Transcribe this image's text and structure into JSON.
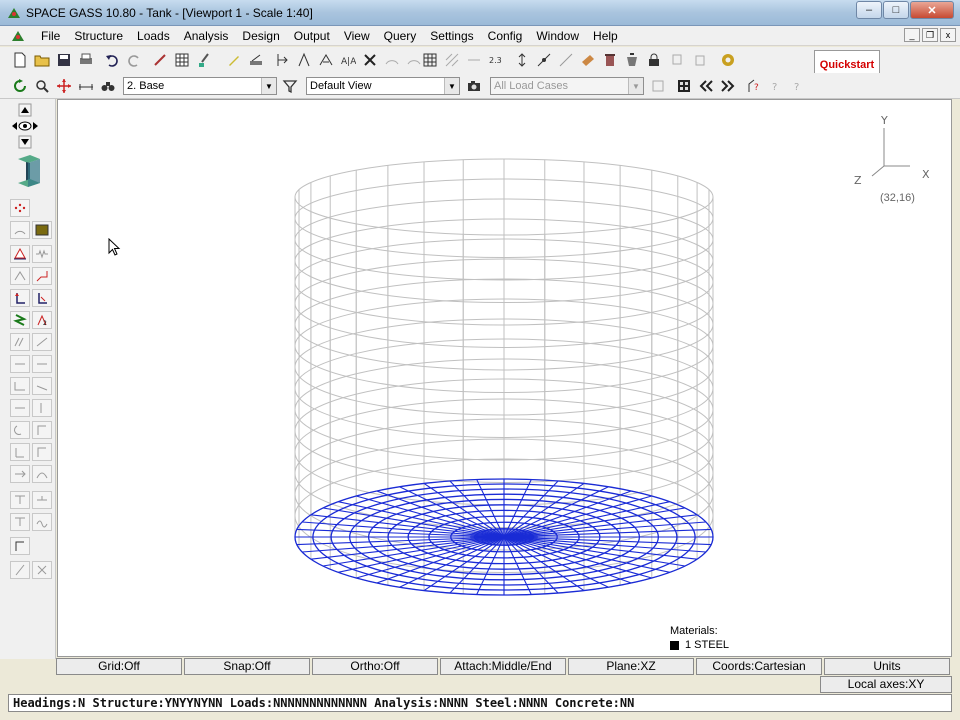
{
  "window": {
    "title": "SPACE GASS 10.80 - Tank - [Viewport 1 - Scale 1:40]",
    "min": "–",
    "max": "□",
    "close": "✕"
  },
  "menu": [
    "File",
    "Structure",
    "Loads",
    "Analysis",
    "Design",
    "Output",
    "View",
    "Query",
    "Settings",
    "Config",
    "Window",
    "Help"
  ],
  "quickstart": "Quickstart Guide",
  "toolbar2": {
    "zone_value": "2. Base",
    "view_value": "Default View",
    "load_cases": "All Load Cases"
  },
  "viewport": {
    "axes": {
      "y": "Y",
      "x": "X",
      "z": "Z"
    },
    "coordinate_readout": "(32,16)",
    "materials_label": "Materials:",
    "material_entry": "1   STEEL"
  },
  "status_toggles": [
    "Grid:Off",
    "Snap:Off",
    "Ortho:Off",
    "Attach:Middle/End",
    "Plane:XZ",
    "Coords:Cartesian",
    "Units"
  ],
  "local_axes": "Local axes:XY",
  "status_line": "Headings:N Structure:YNYYNYNN Loads:NNNNNNNNNNNNN Analysis:NNNN Steel:NNNN Concrete:NN",
  "colors": {
    "mesh_grey": "#c0c0c0",
    "mesh_blue": "#1a2bd6",
    "quickstart_red": "#d40000"
  },
  "icons": [
    "app-icon",
    "new-icon",
    "open-icon",
    "save-icon",
    "print-icon",
    "undo-icon",
    "redo-icon",
    "refresh-icon",
    "zoom-icon",
    "pan-icon",
    "binoculars-icon",
    "filter-icon",
    "camera-icon",
    "prev-icon",
    "next-icon",
    "view-rotate-icon",
    "beam-icon"
  ]
}
